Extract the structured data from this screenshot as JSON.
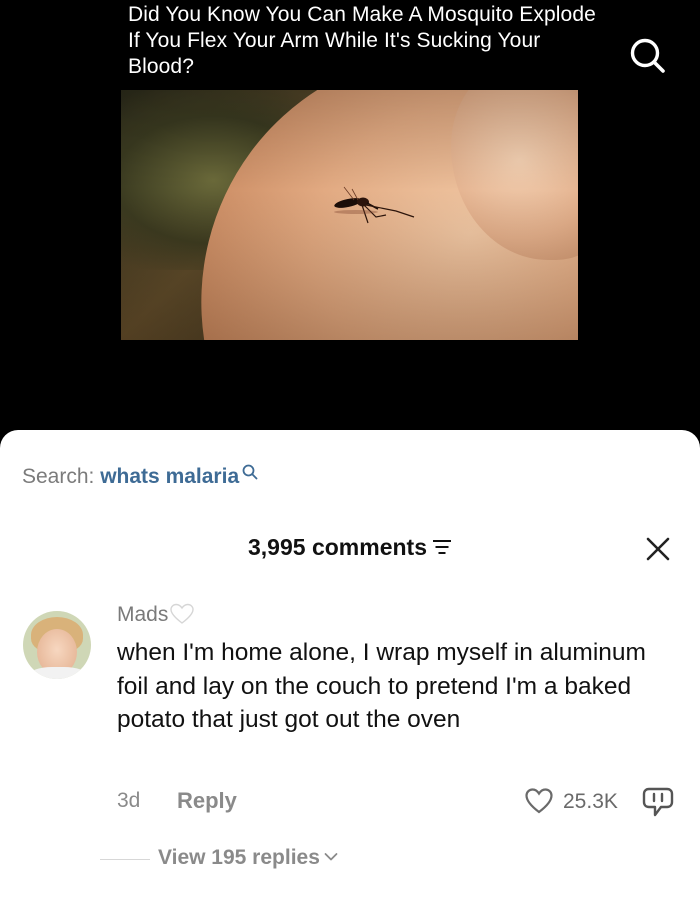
{
  "video": {
    "title": "Did You Know You Can Make A Mosquito Explode If You Flex Your Arm While It's Sucking Your Blood?",
    "search_icon": "search-icon"
  },
  "search": {
    "label": "Search:",
    "query": "whats malaria"
  },
  "comments": {
    "count_label": "3,995 comments",
    "filter_icon": "filter-icon",
    "close_icon": "close-icon"
  },
  "comment": {
    "username": "Mads",
    "text": "when I'm home alone, I wrap myself in aluminum foil and lay on the couch to pretend I'm a baked potato that just got out the oven",
    "time": "3d",
    "reply_label": "Reply",
    "likes": "25.3K",
    "view_replies": "View 195 replies"
  },
  "colors": {
    "link_blue": "#3e6b95",
    "muted_gray": "#8a8a8a",
    "sheet_bg": "#ffffff",
    "video_bg": "#000000"
  }
}
